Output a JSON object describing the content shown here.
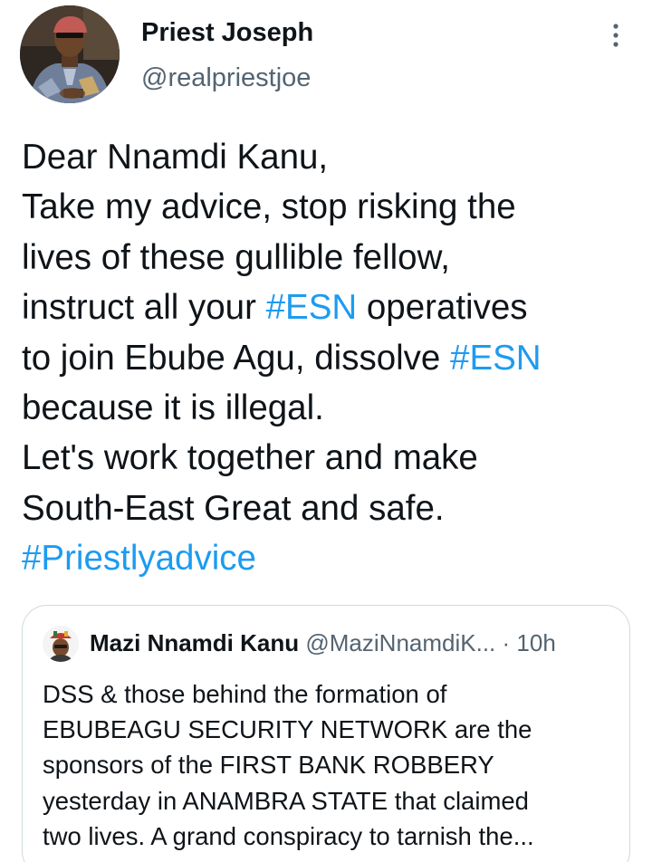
{
  "author": {
    "name": "Priest Joseph",
    "handle": "@realpriestjoe"
  },
  "tweet": {
    "line1": "Dear Nnamdi Kanu,",
    "line2": "Take my advice, stop risking the",
    "line3": "lives of these gullible fellow,",
    "line4_pre": "instruct all your ",
    "line4_tag": "#ESN",
    "line4_post": " operatives",
    "line5_pre": "to join Ebube Agu, dissolve ",
    "line5_tag": "#ESN",
    "line6": "because it is illegal.",
    "line7": "Let's work together and make",
    "line8": "South-East Great and safe.",
    "line9_tag": "#Priestlyadvice"
  },
  "quoted": {
    "name": "Mazi Nnamdi Kanu",
    "handle": "@MaziNnamdiK...",
    "separator": "·",
    "time": "10h",
    "line1": "DSS & those behind the formation of",
    "line2": "EBUBEAGU SECURITY NETWORK are the",
    "line3": "sponsors of the FIRST BANK ROBBERY",
    "line4": "yesterday in ANAMBRA STATE that claimed",
    "line5": "two lives. A grand conspiracy to tarnish the..."
  },
  "icons": {
    "more": "more-vertical-icon"
  },
  "colors": {
    "hashtag": "#1d9bf0",
    "secondary_text": "#536471",
    "primary_text": "#0f1419",
    "border": "#cfd9de"
  }
}
